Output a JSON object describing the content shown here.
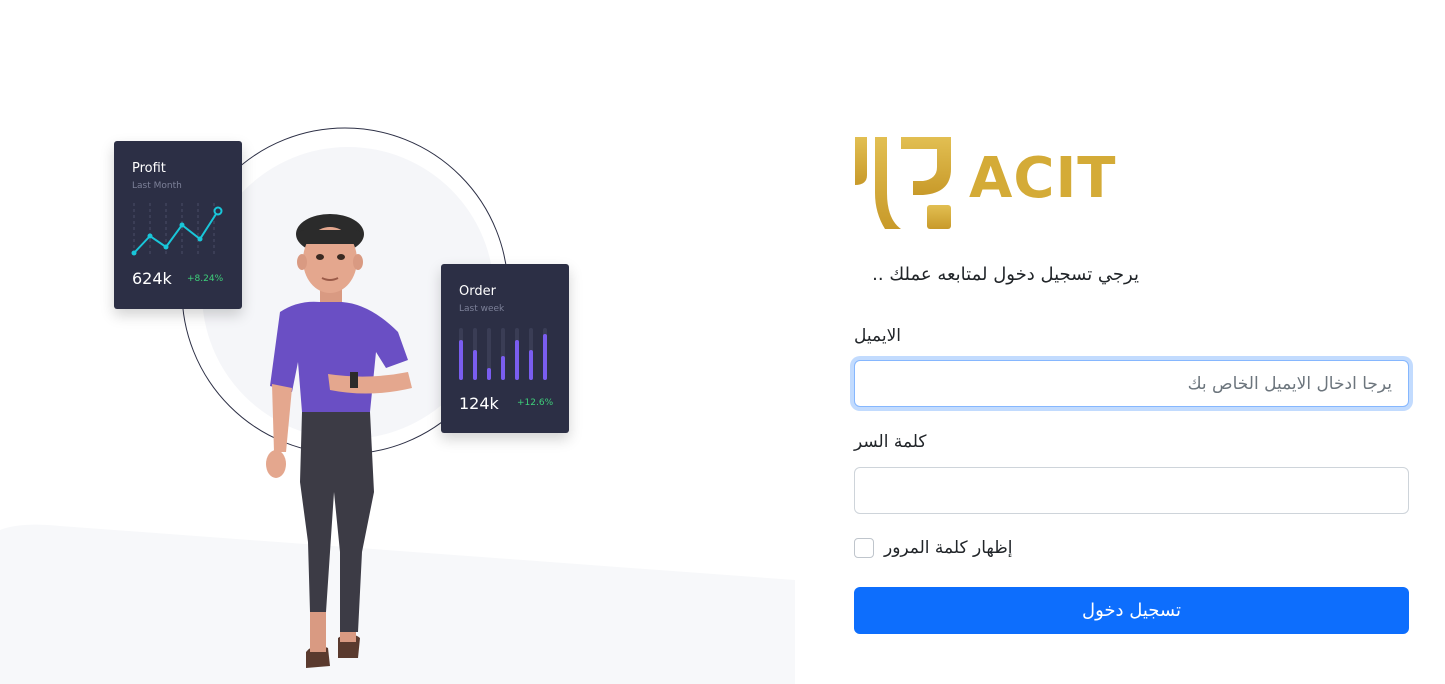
{
  "colors": {
    "brand_gold": "#d4ab37",
    "primary_button": "#0d6efd",
    "card_bg": "#2c2f45",
    "positive_delta": "#3ecf7a",
    "bar_color": "#7a5df0",
    "line_color": "#19c6d9"
  },
  "illustration": {
    "profit_card": {
      "title": "Profit",
      "subtitle": "Last Month",
      "value": "624k",
      "delta": "+8.24%"
    },
    "order_card": {
      "title": "Order",
      "subtitle": "Last week",
      "value": "124k",
      "delta": "+12.6%"
    }
  },
  "logo": {
    "text": "ACIT"
  },
  "form": {
    "intro": "يرجي تسجيل دخول لمتابعه عملك ..",
    "email_label": "الايميل",
    "email_placeholder": "يرجا ادخال الايميل الخاص بك",
    "email_value": "",
    "password_label": "كلمة السر",
    "password_value": "",
    "show_password_label": "إظهار كلمة المرور",
    "show_password_checked": false,
    "submit_label": "تسجيل دخول"
  }
}
